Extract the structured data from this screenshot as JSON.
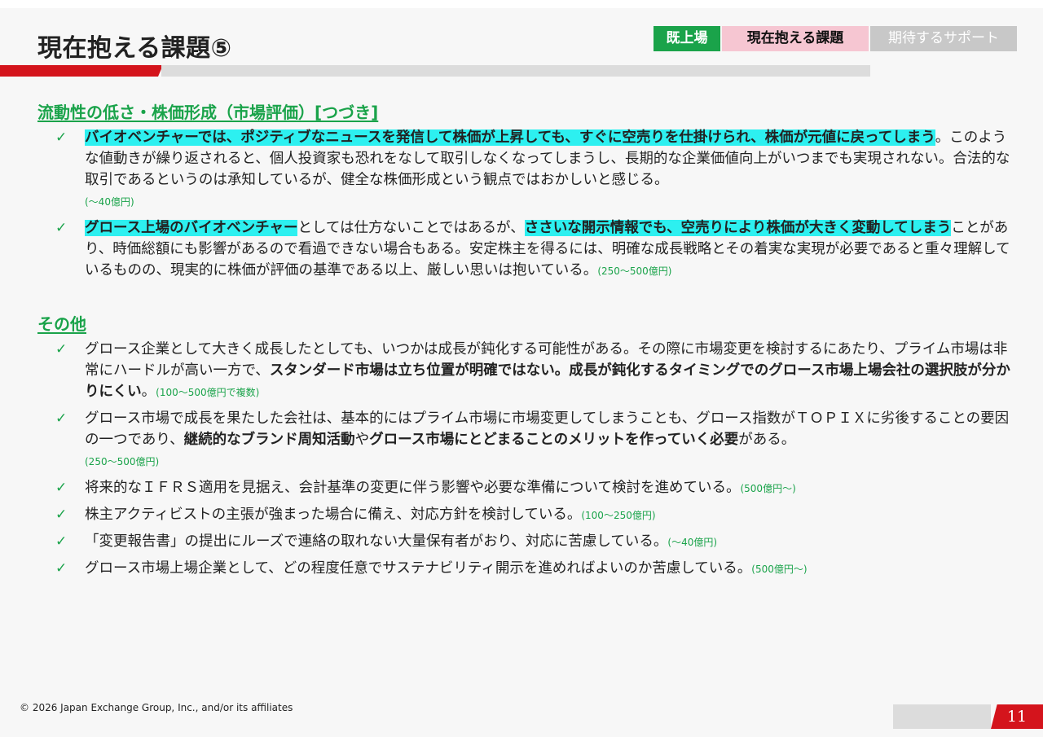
{
  "title": "現在抱える課題⑤",
  "tabs": [
    "既上場",
    "現在抱える課題",
    "期待するサポート"
  ],
  "section1": {
    "heading": "流動性の低さ・株価形成（市場評価）[つづき]",
    "items": [
      {
        "hl1": "バイオベンチャーでは、ポジティブなニュースを発信して株価が上昇しても、すぐに空売りを仕掛けられ、株価が元値に戻ってしまう",
        "text1": "。このような値動きが繰り返されると、個人投資家も恐れをなして取引しなくなってしまうし、長期的な企業価値向上がいつまでも実現されない。合法的な取引であるというのは承知しているが、健全な株価形成という観点ではおかしいと感じる。",
        "note": "(～40億円)"
      },
      {
        "hl1": "グロース上場のバイオベンチャー",
        "text1": "としては仕方ないことではあるが、",
        "hl2": "ささいな開示情報でも、空売りにより株価が大きく変動してしまう",
        "text2": "ことがあり、時価総額にも影響があるので看過できない場合もある。安定株主を得るには、明確な成長戦略とその着実な実現が必要であると重々理解しているものの、現実的に株価が評価の基準である以上、厳しい思いは抱いている。",
        "note": "(250～500億円)"
      }
    ]
  },
  "section2": {
    "heading": "その他",
    "items": [
      {
        "text1": "グロース企業として大きく成長したとしても、いつかは成長が鈍化する可能性がある。その際に市場変更を検討するにあたり、プライム市場は非常にハードルが高い一方で、",
        "bold1": "スタンダード市場は立ち位置が明確ではない。成長が鈍化するタイミングでのグロース市場上場会社の選択肢が分かりにくい",
        "text2": "。",
        "note": "(100～500億円で複数)"
      },
      {
        "text1": "グロース市場で成長を果たした会社は、基本的にはプライム市場に市場変更してしまうことも、グロース指数がＴＯＰＩＸに劣後することの要因の一つであり、",
        "bold1": "継続的なブランド周知活動",
        "text2": "や",
        "bold2": "グロース市場にとどまることのメリットを作っていく必要",
        "text3": "がある。",
        "note": "(250～500億円)"
      },
      {
        "text1": "将来的なＩＦＲＳ適用を見据え、会計基準の変更に伴う影響や必要な準備について検討を進めている。",
        "note": "(500億円～)"
      },
      {
        "text1": "株主アクティビストの主張が強まった場合に備え、対応方針を検討している。",
        "note": "(100～250億円)"
      },
      {
        "text1": "「変更報告書」の提出にルーズで連絡の取れない大量保有者がおり、対応に苦慮している。",
        "note": "(～40億円)"
      },
      {
        "text1": "グロース市場上場企業として、どの程度任意でサステナビリティ開示を進めればよいのか苦慮している。",
        "note": "(500億円～)"
      }
    ]
  },
  "check_icon": "check-mark-icon",
  "footer": {
    "copyright": "© 2026 Japan Exchange Group, Inc., and/or its affiliates",
    "page": "11"
  },
  "colors": {
    "accent_green": "#1aa34a",
    "accent_red": "#d4141c",
    "highlight": "#2df0f0",
    "tab_pink": "#f6c6d2"
  }
}
